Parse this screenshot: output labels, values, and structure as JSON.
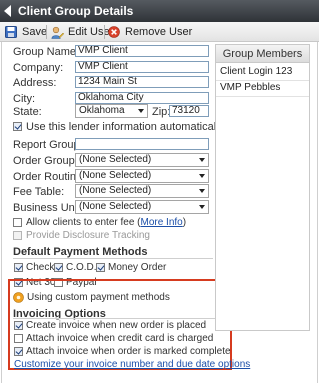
{
  "window": {
    "title": "Client Group Details"
  },
  "toolbar": {
    "save": "Save",
    "edit_user": "Edit User",
    "remove_user": "Remove User"
  },
  "form": {
    "group_name": {
      "label": "Group Name:",
      "value": "VMP Client"
    },
    "company": {
      "label": "Company:",
      "value": "VMP Client"
    },
    "address": {
      "label": "Address:",
      "value": "1234 Main St"
    },
    "city": {
      "label": "City:",
      "value": "Oklahoma City"
    },
    "state": {
      "label": "State:",
      "value": "Oklahoma"
    },
    "zip": {
      "label": "Zip:",
      "value": "73120"
    },
    "use_lender_info": {
      "label": "Use this lender information automatically",
      "checked": true
    },
    "report_group": {
      "label": "Report Group:",
      "value": ""
    },
    "order_group": {
      "label": "Order Group:",
      "value": "(None Selected)"
    },
    "order_routing": {
      "label": "Order Routing:",
      "value": "(None Selected)"
    },
    "fee_table": {
      "label": "Fee Table:",
      "value": "(None Selected)"
    },
    "business_units": {
      "label": "Business Units:",
      "value": "(None Selected)"
    },
    "allow_fee": {
      "label": "Allow clients to enter fee",
      "link": "More Info",
      "checked": false
    },
    "disclosure": {
      "label": "Provide Disclosure Tracking",
      "checked": false
    }
  },
  "payment": {
    "heading": "Default Payment Methods",
    "methods": [
      {
        "label": "Check",
        "checked": true
      },
      {
        "label": "C.O.D.",
        "checked": true
      },
      {
        "label": "Money Order",
        "checked": true
      },
      {
        "label": "Net 30",
        "checked": true
      },
      {
        "label": "Paypal",
        "checked": false
      }
    ],
    "custom_note": "Using custom payment methods"
  },
  "invoicing": {
    "heading": "Invoicing Options",
    "options": [
      {
        "label": "Create invoice when new order is placed",
        "checked": true
      },
      {
        "label": "Attach invoice when credit card is charged",
        "checked": false
      },
      {
        "label": "Attach invoice when order is marked complete",
        "checked": true
      }
    ],
    "customize_link": "Customize your invoice number and due date options"
  },
  "members": {
    "heading": "Group Members",
    "items": [
      "Client Login 123",
      "VMP Pebbles"
    ]
  },
  "colors": {
    "title_bar": "#3a3f45",
    "highlight_border": "#d63b1f",
    "link": "#1c4fa8"
  }
}
